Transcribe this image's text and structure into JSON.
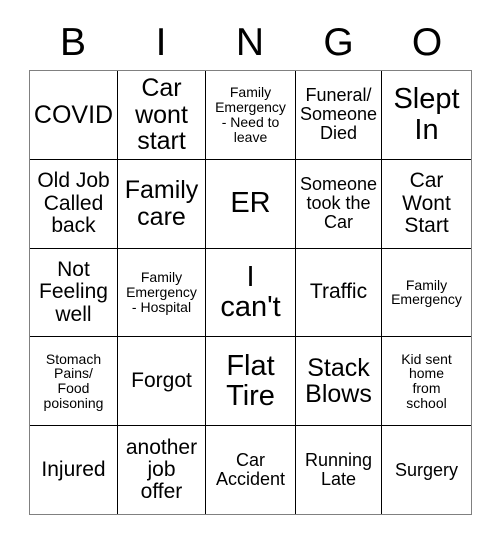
{
  "card": {
    "type": "bingo-card",
    "columns": 5,
    "rows": 5,
    "header_letters": [
      "B",
      "I",
      "N",
      "G",
      "O"
    ],
    "colors": {
      "background": "#ffffff",
      "text": "#000000",
      "grid_line": "#000000",
      "outer_border": "#808080"
    },
    "rows_data": [
      [
        {
          "text": "COVID",
          "size": "lg"
        },
        {
          "text": "Car\nwont\nstart",
          "size": "lg"
        },
        {
          "text": "Family\nEmergency\n- Need to\nleave",
          "size": "xs"
        },
        {
          "text": "Funeral/\nSomeone\nDied",
          "size": "sm"
        },
        {
          "text": "Slept\nIn",
          "size": "xl"
        }
      ],
      [
        {
          "text": "Old Job\nCalled\nback",
          "size": "md"
        },
        {
          "text": "Family\ncare",
          "size": "lg"
        },
        {
          "text": "ER",
          "size": "xl"
        },
        {
          "text": "Someone\ntook the\nCar",
          "size": "sm"
        },
        {
          "text": "Car\nWont\nStart",
          "size": "md"
        }
      ],
      [
        {
          "text": "Not\nFeeling\nwell",
          "size": "md"
        },
        {
          "text": "Family\nEmergency\n- Hospital",
          "size": "xs"
        },
        {
          "text": "I\ncan't",
          "size": "xl"
        },
        {
          "text": "Traffic",
          "size": "md"
        },
        {
          "text": "Family\nEmergency",
          "size": "xs"
        }
      ],
      [
        {
          "text": "Stomach\nPains/\nFood\npoisoning",
          "size": "xs"
        },
        {
          "text": "Forgot",
          "size": "md"
        },
        {
          "text": "Flat\nTire",
          "size": "xl"
        },
        {
          "text": "Stack\nBlows",
          "size": "lg"
        },
        {
          "text": "Kid sent\nhome\nfrom\nschool",
          "size": "xs"
        }
      ],
      [
        {
          "text": "Injured",
          "size": "md"
        },
        {
          "text": "another\njob\noffer",
          "size": "md"
        },
        {
          "text": "Car\nAccident",
          "size": "sm"
        },
        {
          "text": "Running\nLate",
          "size": "sm"
        },
        {
          "text": "Surgery",
          "size": "sm"
        }
      ]
    ]
  }
}
